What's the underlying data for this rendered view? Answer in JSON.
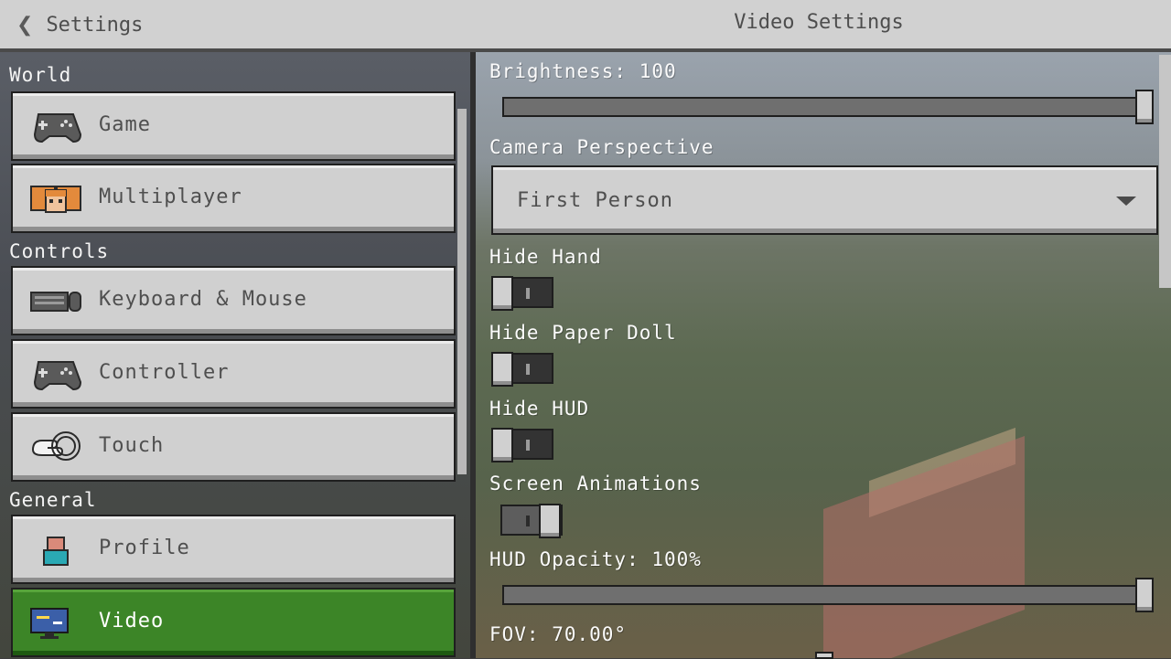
{
  "header": {
    "back_label": "Settings",
    "title": "Video Settings"
  },
  "sidebar": {
    "sections": [
      {
        "title": "World",
        "items": [
          {
            "label": "Game",
            "icon": "controller-icon"
          },
          {
            "label": "Multiplayer",
            "icon": "players-icon"
          }
        ]
      },
      {
        "title": "Controls",
        "items": [
          {
            "label": "Keyboard & Mouse",
            "icon": "keyboard-icon"
          },
          {
            "label": "Controller",
            "icon": "controller-icon"
          },
          {
            "label": "Touch",
            "icon": "touch-icon"
          }
        ]
      },
      {
        "title": "General",
        "items": [
          {
            "label": "Profile",
            "icon": "profile-icon"
          },
          {
            "label": "Video",
            "icon": "monitor-icon",
            "active": true
          }
        ]
      }
    ]
  },
  "settings": {
    "brightness": {
      "label": "Brightness: 100",
      "value": 100,
      "max": 100
    },
    "camera": {
      "label": "Camera Perspective",
      "value": "First Person"
    },
    "hide_hand": {
      "label": "Hide Hand",
      "on": false
    },
    "hide_paper_doll": {
      "label": "Hide Paper Doll",
      "on": false
    },
    "hide_hud": {
      "label": "Hide HUD",
      "on": false
    },
    "screen_animations": {
      "label": "Screen Animations",
      "on": true
    },
    "hud_opacity": {
      "label": "HUD Opacity: 100%",
      "value": 100,
      "max": 100
    },
    "fov": {
      "label": "FOV: 70.00°"
    }
  },
  "colors": {
    "active": "#3c8527",
    "button": "#d0d0d0",
    "topbar": "#d1d1d1"
  }
}
